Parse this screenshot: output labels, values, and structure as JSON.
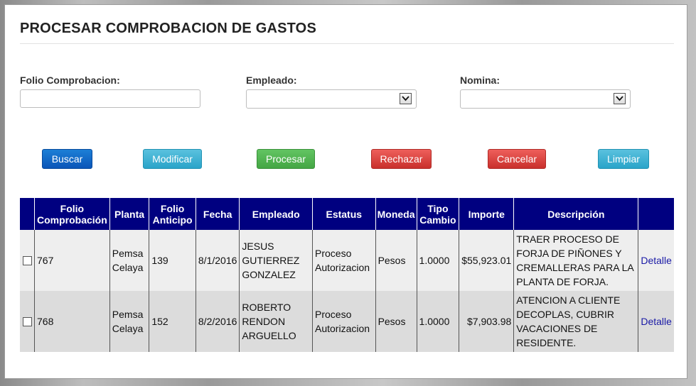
{
  "page": {
    "title": "PROCESAR COMPROBACION DE GASTOS"
  },
  "filters": {
    "folio_label": "Folio Comprobacion:",
    "folio_value": "",
    "empleado_label": "Empleado:",
    "empleado_value": "",
    "nomina_label": "Nomina:",
    "nomina_value": ""
  },
  "buttons": {
    "buscar": "Buscar",
    "modificar": "Modificar",
    "procesar": "Procesar",
    "rechazar": "Rechazar",
    "cancelar": "Cancelar",
    "limpiar": "Limpiar"
  },
  "colors": {
    "header_bg": "#000080",
    "buscar": "#0a55b8",
    "info": "#2aa4c9",
    "success": "#44a644",
    "danger": "#c9302c"
  },
  "table": {
    "headers": {
      "folio_comprobacion": [
        "Folio",
        "Comprobación"
      ],
      "planta": "Planta",
      "folio_anticipo": [
        "Folio",
        "Anticipo"
      ],
      "fecha": "Fecha",
      "empleado": "Empleado",
      "estatus": "Estatus",
      "moneda": "Moneda",
      "tipo_cambio": [
        "Tipo",
        "Cambio"
      ],
      "importe": "Importe",
      "descripcion": "Descripción"
    },
    "rows": [
      {
        "checked": false,
        "folio": "767",
        "planta": [
          "Pemsa",
          "Celaya"
        ],
        "anticipo": "139",
        "fecha": "8/1/2016",
        "empleado": [
          "JESUS",
          "GUTIERREZ",
          "GONZALEZ"
        ],
        "estatus": [
          "Proceso",
          "Autorizacion"
        ],
        "moneda": "Pesos",
        "tipo_cambio": "1.0000",
        "importe": "$55,923.01",
        "descripcion": [
          "TRAER PROCESO DE",
          "FORJA DE PIÑONES Y",
          "CREMALLERAS PARA LA",
          "PLANTA DE FORJA."
        ],
        "detalle": "Detalle"
      },
      {
        "checked": false,
        "folio": "768",
        "planta": [
          "Pemsa",
          "Celaya"
        ],
        "anticipo": "152",
        "fecha": "8/2/2016",
        "empleado": [
          "ROBERTO",
          "RENDON",
          "ARGUELLO"
        ],
        "estatus": [
          "Proceso",
          "Autorizacion"
        ],
        "moneda": "Pesos",
        "tipo_cambio": "1.0000",
        "importe": "$7,903.98",
        "descripcion": [
          "ATENCION A CLIENTE",
          "DECOPLAS, CUBRIR",
          "VACACIONES DE",
          "RESIDENTE."
        ],
        "detalle": "Detalle"
      }
    ]
  }
}
